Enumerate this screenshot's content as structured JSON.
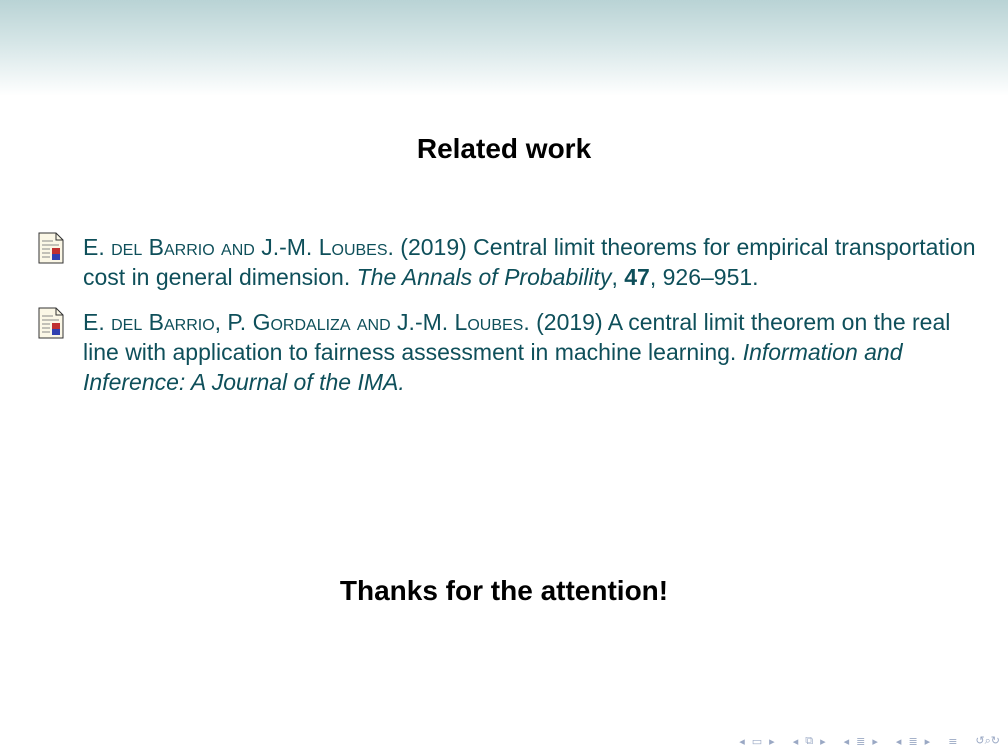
{
  "frame": {
    "title": "Related work"
  },
  "references": [
    {
      "authors_parts": [
        {
          "text": "E. ",
          "style": "normal"
        },
        {
          "text": "del Barrio and J.-M. Loubes",
          "style": "sc"
        },
        {
          "text": ". (2019) Central limit theorems for empirical transportation cost in general dimension. ",
          "style": "normal"
        },
        {
          "text": "The Annals of Probability",
          "style": "it"
        },
        {
          "text": ", ",
          "style": "normal"
        },
        {
          "text": "47",
          "style": "bf"
        },
        {
          "text": ", 926–951.",
          "style": "normal"
        }
      ]
    },
    {
      "authors_parts": [
        {
          "text": "E. ",
          "style": "normal"
        },
        {
          "text": "del Barrio, P. Gordaliza and J.-M. Loubes",
          "style": "sc"
        },
        {
          "text": ". (2019) A central limit theorem on the real line with application to fairness assessment in machine learning. ",
          "style": "normal"
        },
        {
          "text": "Information and Inference: A Journal of the IMA.",
          "style": "it"
        }
      ]
    }
  ],
  "closing": {
    "text": "Thanks for the attention!"
  },
  "navigation": {
    "icons": [
      "nav-prev-icon",
      "frame-icon",
      "nav-next-icon",
      "nav-prev-icon",
      "subsection-icon",
      "nav-next-icon",
      "nav-prev-icon",
      "section-icon",
      "nav-next-icon",
      "nav-prev-icon",
      "section-icon",
      "nav-next-icon",
      "toc-icon",
      "search-icon"
    ],
    "color": "#9aa8c4"
  },
  "colors": {
    "reference_text": "#0e4f5a",
    "header_band": "#b9d3d5"
  }
}
